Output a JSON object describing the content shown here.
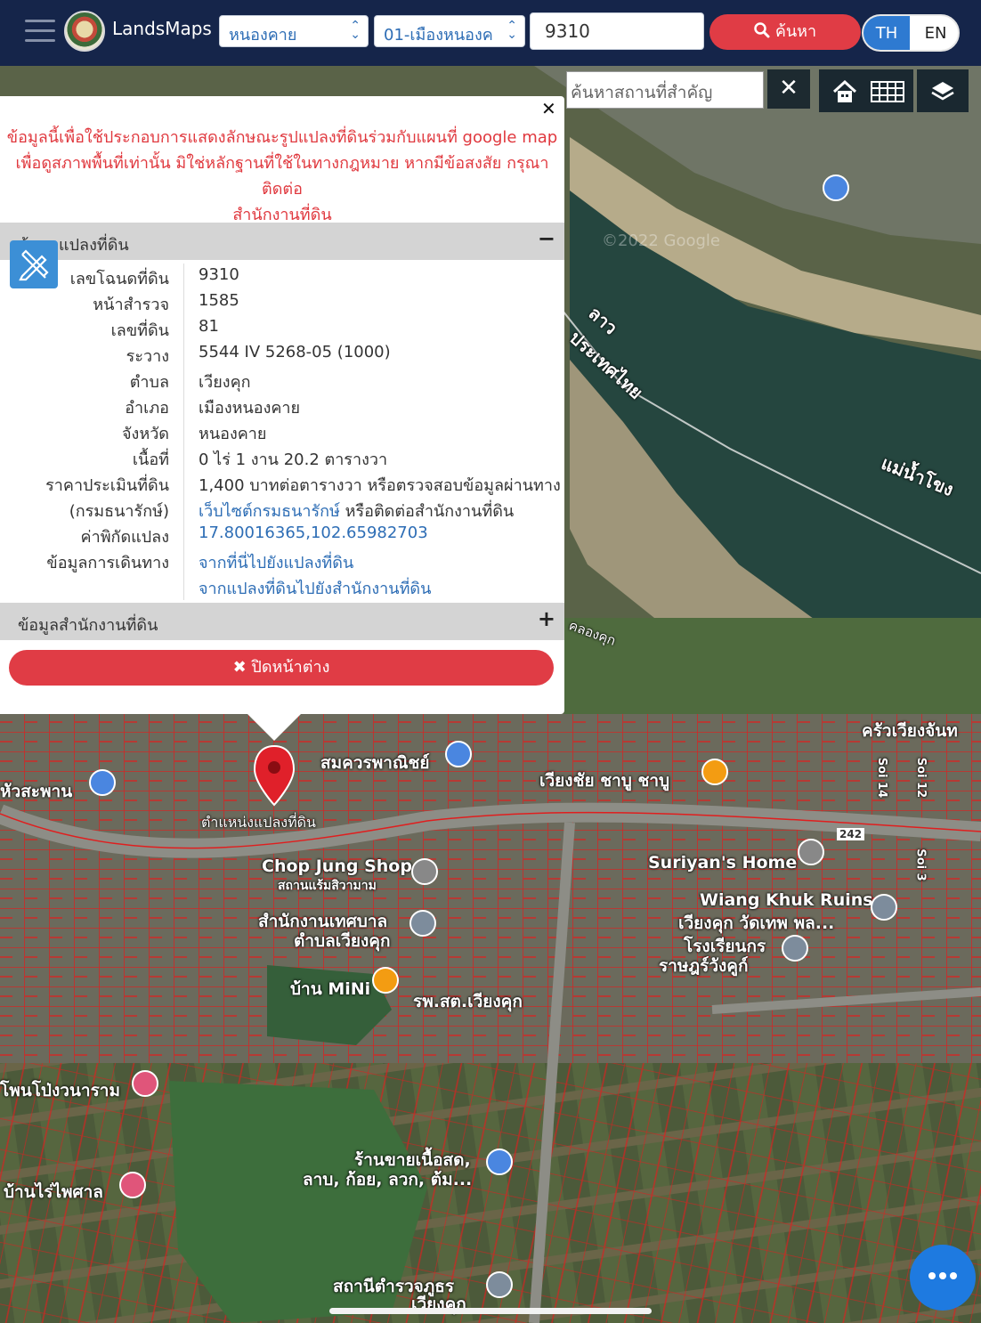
{
  "header": {
    "brand": "LandsMaps",
    "province": "หนองคาย",
    "amphoe": "01-เมืองหนองค",
    "search_value": "9310",
    "search_button": "ค้นหา",
    "lang_th": "TH",
    "lang_en": "EN"
  },
  "map_tools": {
    "place_search_placeholder": "ค้นหาสถานที่สำคัญ",
    "clear": "✕"
  },
  "popup": {
    "disclaimer_line1": "ข้อมูลนี้เพื่อใช้ประกอบการแสดงลักษณะรูปแปลงที่ดินร่วมกับแผนที่ google map",
    "disclaimer_line2": "เพื่อดูสภาพพื้นที่เท่านั้น มิใช่หลักฐานที่ใช้ในทางกฎหมาย หากมีข้อสงสัย กรุณาติดต่อ",
    "disclaimer_line3": "สำนักงานที่ดิน",
    "parcel_section_title": "ข้อมูลแปลงที่ดิน",
    "parcel_toggle": "−",
    "office_section_title": "ข้อมูลสำนักงานที่ดิน",
    "office_toggle": "+",
    "close_page": "✖ ปิดหน้าต่าง",
    "rows": [
      {
        "label": "เลขโฉนดที่ดิน",
        "value": "9310"
      },
      {
        "label": "หน้าสำรวจ",
        "value": "1585"
      },
      {
        "label": "เลขที่ดิน",
        "value": "81"
      },
      {
        "label": "ระวาง",
        "value": "5544 IV 5268-05 (1000)"
      },
      {
        "label": "ตำบล",
        "value": "เวียงคุก"
      },
      {
        "label": "อำเภอ",
        "value": "เมืองหนองคาย"
      },
      {
        "label": "จังหวัด",
        "value": "หนองคาย"
      },
      {
        "label": "เนื้อที่",
        "value": "0 ไร่ 1 งาน 20.2 ตารางวา"
      },
      {
        "label": "ราคาประเมินที่ดิน",
        "value": "1,400 บาทต่อตารางวา หรือตรวจสอบข้อมูลผ่านทาง"
      },
      {
        "label": "(กรมธนารักษ์)",
        "link": "เว็บไซต์กรมธนารักษ์",
        "value": " หรือติดต่อสำนักงานที่ดิน"
      },
      {
        "label": "ค่าพิกัดแปลง",
        "value": "17.80016365,102.65982703"
      },
      {
        "label": "ข้อมูลการเดินทาง",
        "value": "จากที่นี่ไปยังแปลงที่ดิน"
      },
      {
        "label": "",
        "value": "จากแปลงที่ดินไปยังสำนักงานที่ดิน"
      }
    ]
  },
  "map_labels": {
    "river_lao": "ลาว",
    "river_thai": "ประเทศไทย",
    "river_mekong": "แม่น้ำโขง",
    "canal": "คลองคุก",
    "kruaviang": "ครัวเวียงจันท",
    "sommuang": "สมควรพาณิชย์",
    "wiangchai": "เวียงชัย ชาบู ชาบู",
    "huasaphan": "หัวสะพาน",
    "parcel_marker": "ตำแหน่งแปลงที่ดิน",
    "chopjung": "Chop Jung Shop",
    "chopjung_sub": "สถานแร้มสิวามาม",
    "suriyan": "Suriyan's Home",
    "wiangkhuk": "Wiang Khuk Ruins,",
    "wiangkhuk_sub": "เวียงคุก วัดเทพ พล...",
    "tessaban1": "สำนักงานเทศบาล",
    "tessaban2": "ตำบลเวียงคุก",
    "school1": "โรงเรียนกร",
    "school2": "ราษฎร์วังคูก์",
    "mini": "บ้าน MiNi",
    "hospital": "รพ.สต.เวียงคุก",
    "phonpong": "โพนโป่งวนาราม",
    "bannai": "บ้านไร่ไพศาล",
    "meatshop1": "ร้านขายเนื้อสด,",
    "meatshop2": "ลาบ, ก้อย, ลวก, ต้ม...",
    "police1": "สถานีตำรวจภูธร",
    "police2": "เวียงคุก",
    "soi14": "Soi 14",
    "soi12": "Soi 12",
    "soi3": "Soi 3",
    "route": "242",
    "watermark": "©2022 Google"
  }
}
